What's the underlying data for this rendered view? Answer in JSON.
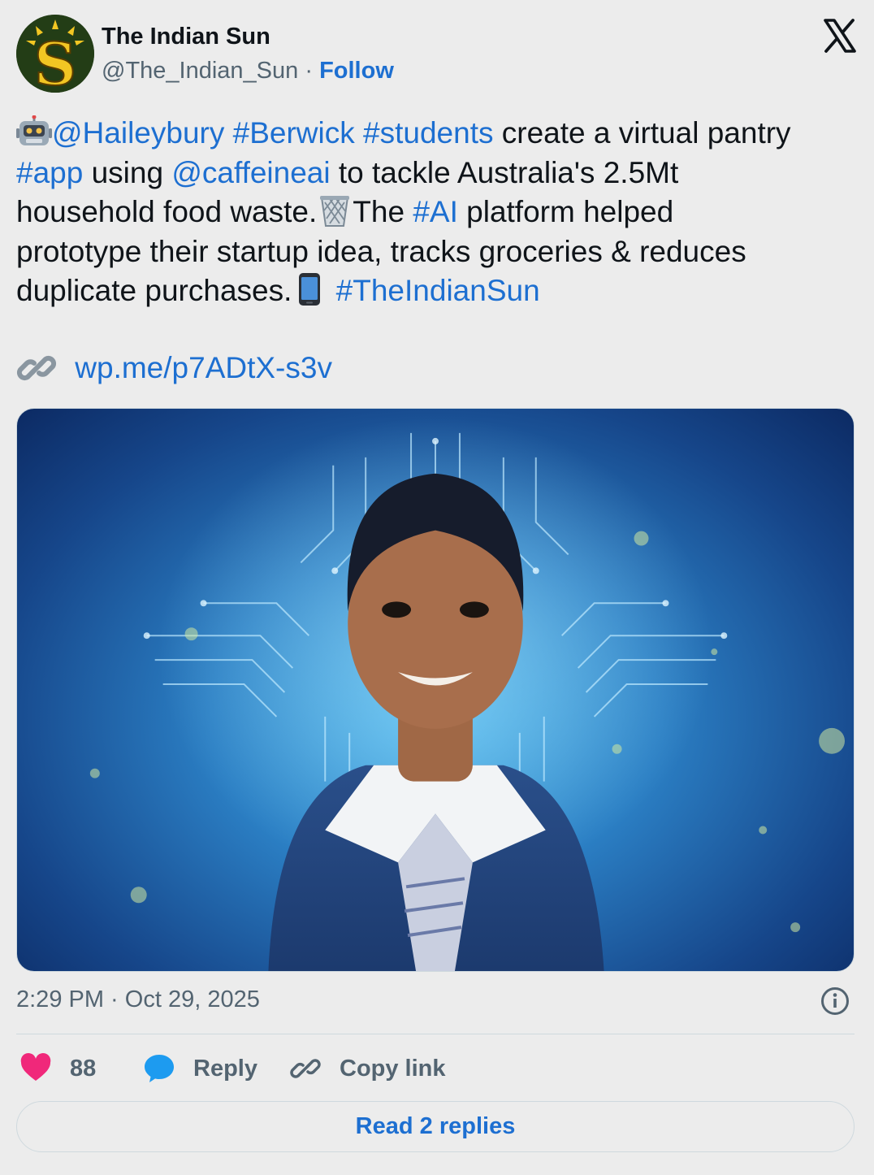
{
  "author": {
    "name": "The Indian Sun",
    "handle": "@The_Indian_Sun",
    "separator": " · ",
    "follow_label": "Follow",
    "avatar_letter": "S"
  },
  "tweet": {
    "segments": [
      {
        "type": "emoji",
        "icon": "robot-emoji-icon"
      },
      {
        "type": "link",
        "text": "@Haileybury"
      },
      {
        "type": "text",
        "text": " "
      },
      {
        "type": "link",
        "text": "#Berwick"
      },
      {
        "type": "text",
        "text": " "
      },
      {
        "type": "link",
        "text": "#students"
      },
      {
        "type": "text",
        "text": " create a virtual pantry\n"
      },
      {
        "type": "link",
        "text": "#app"
      },
      {
        "type": "text",
        "text": " using "
      },
      {
        "type": "link",
        "text": "@caffeineai"
      },
      {
        "type": "text",
        "text": " to tackle Australia's 2.5Mt\nhousehold food waste."
      },
      {
        "type": "emoji",
        "icon": "wastebasket-emoji-icon"
      },
      {
        "type": "text",
        "text": "The "
      },
      {
        "type": "link",
        "text": "#AI"
      },
      {
        "type": "text",
        "text": " platform helped\nprototype their startup idea, tracks groceries & reduces\nduplicate purchases."
      },
      {
        "type": "emoji",
        "icon": "mobile-phone-emoji-icon"
      },
      {
        "type": "text",
        "text": " "
      },
      {
        "type": "link",
        "text": "#TheIndianSun"
      }
    ],
    "url_icon": "link-chain-icon",
    "url": "wp.me/p7ADtX-s3v",
    "media_description_icon": "student-photo-image",
    "timestamp": "2:29 PM · Oct 29, 2025"
  },
  "actions": {
    "like_count": "88",
    "reply_label": "Reply",
    "copy_label": "Copy link",
    "read_replies_label": "Read 2 replies"
  },
  "colors": {
    "link": "#1d6fd1",
    "secondary_text": "#536471",
    "background": "#ececec",
    "like_heart": "#f0287a",
    "reply_bubble": "#1d9bf0"
  }
}
